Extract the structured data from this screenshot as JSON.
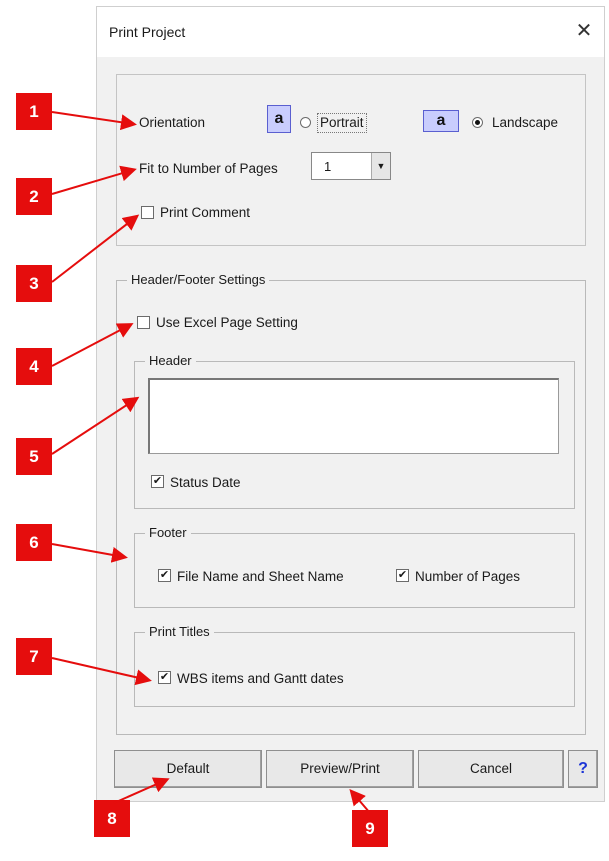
{
  "dialog": {
    "title": "Print Project",
    "close_glyph": "✕",
    "orientation": {
      "label": "Orientation",
      "sample_glyph": "a",
      "portrait_label": "Portrait",
      "landscape_label": "Landscape",
      "selected": "Landscape"
    },
    "fit_pages": {
      "label": "Fit to Number of Pages",
      "value": "1",
      "arrow_glyph": "▼"
    },
    "print_comment": {
      "label": "Print Comment",
      "checked": false
    },
    "header_footer": {
      "legend": "Header/Footer Settings",
      "use_excel": {
        "label": "Use Excel Page Setting",
        "checked": false
      },
      "header": {
        "legend": "Header",
        "text_value": "",
        "status_date": {
          "label": "Status Date",
          "checked": true
        }
      },
      "footer": {
        "legend": "Footer",
        "file_name": {
          "label": "File Name and Sheet Name",
          "checked": true
        },
        "num_pages": {
          "label": "Number of Pages",
          "checked": true
        }
      },
      "print_titles": {
        "legend": "Print Titles",
        "wbs": {
          "label": "WBS items and Gantt dates",
          "checked": true
        }
      }
    },
    "buttons": {
      "default": "Default",
      "preview_print": "Preview/Print",
      "cancel": "Cancel",
      "help": "?"
    },
    "check_glyph": "✔"
  },
  "annotations": {
    "color": "#e50d0d",
    "markers": [
      "1",
      "2",
      "3",
      "4",
      "5",
      "6",
      "7",
      "8",
      "9"
    ]
  }
}
